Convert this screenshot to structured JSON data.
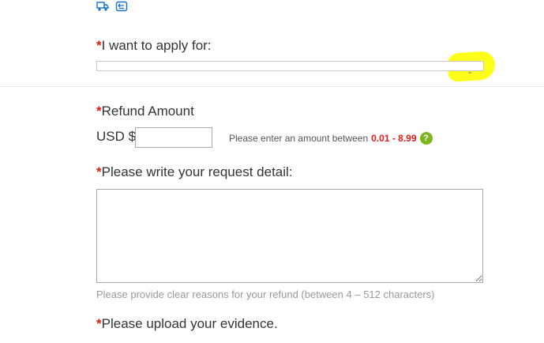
{
  "top_icons": [
    "delivery-truck-icon",
    "return-box-icon"
  ],
  "apply_for": {
    "required_mark": "*",
    "label": "I want to apply for:",
    "selected_value": ""
  },
  "refund_amount": {
    "required_mark": "*",
    "label": "Refund Amount",
    "currency_label": "USD $",
    "value": "",
    "hint_prefix": "Please enter an amount between",
    "hint_range": "0.01 - 8.99",
    "help_icon": "?"
  },
  "request_detail": {
    "required_mark": "*",
    "label": "Please write your request detail:",
    "value": "",
    "hint": "Please provide clear reasons for your refund (between 4 – 512 characters)"
  },
  "evidence": {
    "required_mark": "*",
    "label": "Please upload your evidence."
  },
  "colors": {
    "required": "#e31b1b",
    "highlight": "#ffff1a",
    "help_icon_bg": "#7cb61d",
    "accent_icon": "#1a73c9"
  }
}
